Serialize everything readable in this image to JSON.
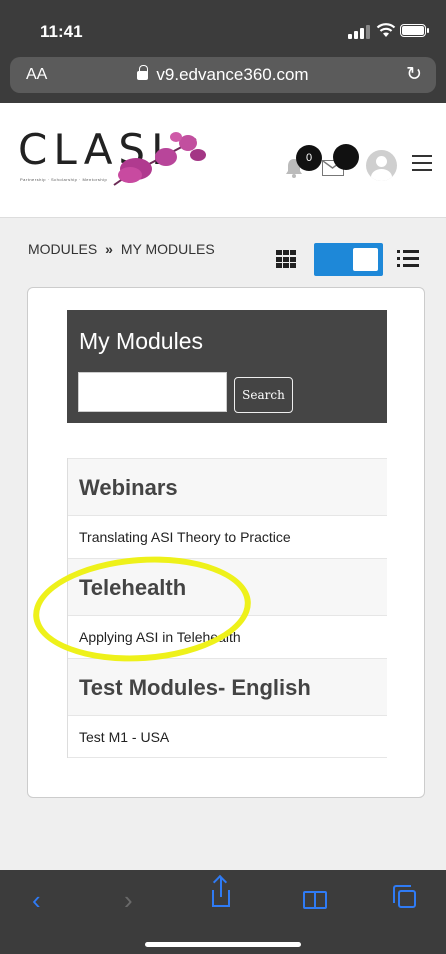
{
  "status": {
    "time": "11:41"
  },
  "browser": {
    "text_size": "AA",
    "url": "v9.edvance360.com"
  },
  "header": {
    "logo_text": "CLASI",
    "logo_tagline": "Partnership · Scholarship · Mentorship",
    "notification_count": "0"
  },
  "breadcrumb": {
    "first": "MODULES",
    "separator": "»",
    "second": "MY MODULES"
  },
  "search": {
    "title": "My Modules",
    "input_value": "",
    "button_label": "Search"
  },
  "groups": [
    {
      "title": "Webinars",
      "items": [
        "Translating ASI Theory to Practice"
      ]
    },
    {
      "title": "Telehealth",
      "items": [
        "Applying ASI in Telehealth"
      ]
    },
    {
      "title": "Test Modules- English",
      "items": [
        "Test M1 - USA"
      ]
    }
  ],
  "colors": {
    "accent": "#1e88d8",
    "highlight": "#eef11a",
    "ios_blue": "#2f7bf5"
  }
}
